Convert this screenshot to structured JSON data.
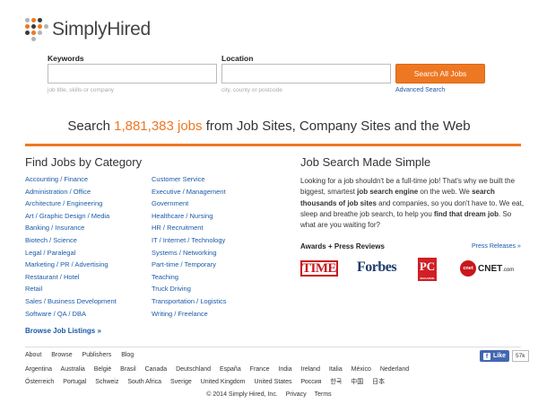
{
  "logo": {
    "text": "SimplyHired",
    "dot_colors": [
      "#ee7722",
      "#3a3a3a",
      "#b3b3b3"
    ]
  },
  "search": {
    "keywords_label": "Keywords",
    "keywords_value": "",
    "keywords_hint": "job title, skills or company",
    "location_label": "Location",
    "location_value": "",
    "location_hint": "city, county or postcode",
    "button_label": "Search All Jobs",
    "advanced_label": "Advanced Search"
  },
  "headline": {
    "prefix": "Search",
    "count": "1,881,383 jobs",
    "suffix": "from Job Sites, Company Sites and the Web"
  },
  "categories": {
    "title": "Find Jobs by Category",
    "left": [
      "Accounting / Finance",
      "Administration / Office",
      "Architecture / Engineering",
      "Art / Graphic Design / Media",
      "Banking / Insurance",
      "Biotech / Science",
      "Legal / Paralegal",
      "Marketing / PR / Advertising",
      "Restaurant / Hotel",
      "Retail",
      "Sales / Business Development",
      "Software / QA / DBA"
    ],
    "right": [
      "Customer Service",
      "Executive / Management",
      "Government",
      "Healthcare / Nursing",
      "HR / Recruitment",
      "IT / Internet / Technology",
      "Systems / Networking",
      "Part-time / Temporary",
      "Teaching",
      "Truck Driving",
      "Transportation / Logistics",
      "Writing / Freelance"
    ],
    "browse_label": "Browse Job Listings »"
  },
  "made_simple": {
    "title": "Job Search Made Simple",
    "t1": "Looking for a job shouldn't be a full-time job! That's why we built the biggest, smartest ",
    "b1": "job search engine",
    "t2": " on the web. We ",
    "b2": "search thousands of job sites",
    "t3": " and companies, so you don't have to. We eat, sleep and breathe job search, to help you ",
    "b3": "find that dream job",
    "t4": ". So what are you waiting for?",
    "awards_title": "Awards + Press Reviews",
    "press_link": "Press Releases »",
    "awards": {
      "time": "TIME",
      "forbes": "Forbes",
      "pc": "PC",
      "pc_small": "MAGAZINE",
      "cnet_circle": "cnet",
      "cnet_word": "CNET",
      "cnet_small": ".com"
    }
  },
  "footer": {
    "links": [
      "About",
      "Browse",
      "Publishers",
      "Blog"
    ],
    "like_label": "Like",
    "like_count": "57k",
    "countries_row1": [
      "Argentina",
      "Australia",
      "België",
      "Brasil",
      "Canada",
      "Deutschland",
      "España",
      "France",
      "India",
      "Ireland",
      "Italia",
      "México",
      "Nederland"
    ],
    "countries_row2": [
      "Österreich",
      "Portugal",
      "Schweiz",
      "South Africa",
      "Sverige",
      "United Kingdom",
      "United States",
      "Россия",
      "한국",
      "中国",
      "日本"
    ],
    "copyright": "© 2014 Simply Hired, Inc.",
    "privacy": "Privacy",
    "terms": "Terms"
  }
}
